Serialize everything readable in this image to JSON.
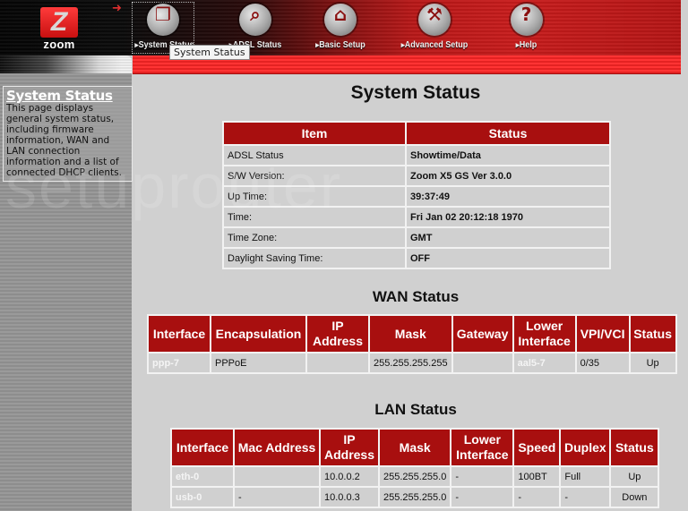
{
  "brand": {
    "logo_letter": "Z",
    "logo_text": "zoom"
  },
  "nav": [
    {
      "label": "System Status",
      "icon": "folders-icon",
      "glyph": "❐",
      "active": true
    },
    {
      "label": "ADSL Status",
      "icon": "magnifier-icon",
      "glyph": "⌕"
    },
    {
      "label": "Basic Setup",
      "icon": "house-icon",
      "glyph": "⌂"
    },
    {
      "label": "Advanced Setup",
      "icon": "wrench-icon",
      "glyph": "⚒"
    },
    {
      "label": "Help",
      "icon": "question-icon",
      "glyph": "?"
    }
  ],
  "tooltip": "System Status",
  "sidebar": {
    "title": "System Status",
    "text": "This page displays general system status, including firmware information, WAN and LAN connection information and a list of connected DHCP clients."
  },
  "watermark": "setuprouter",
  "page": {
    "title": "System Status"
  },
  "system": {
    "headers": [
      "Item",
      "Status"
    ],
    "rows": [
      [
        "ADSL Status",
        "Showtime/Data"
      ],
      [
        "S/W Version:",
        "Zoom X5 GS Ver 3.0.0"
      ],
      [
        "Up Time:",
        "39:37:49"
      ],
      [
        "Time:",
        "Fri Jan 02 20:12:18 1970"
      ],
      [
        "Time Zone:",
        "GMT"
      ],
      [
        "Daylight Saving Time:",
        "OFF"
      ]
    ]
  },
  "wan": {
    "title": "WAN Status",
    "headers": [
      "Interface",
      "Encapsulation",
      "IP Address",
      "Mask",
      "Gateway",
      "Lower Interface",
      "VPI/VCI",
      "Status"
    ],
    "rows": [
      [
        "ppp-7",
        "PPPoE",
        "",
        "255.255.255.255",
        "",
        "aal5-7",
        "0/35",
        "Up"
      ]
    ]
  },
  "lan": {
    "title": "LAN Status",
    "headers": [
      "Interface",
      "Mac Address",
      "IP Address",
      "Mask",
      "Lower Interface",
      "Speed",
      "Duplex",
      "Status"
    ],
    "rows": [
      [
        "eth-0",
        "",
        "10.0.0.2",
        "255.255.255.0",
        "-",
        "100BT",
        "Full",
        "Up"
      ],
      [
        "usb-0",
        "-",
        "10.0.0.3",
        "255.255.255.0",
        "-",
        "-",
        "-",
        "Down"
      ]
    ]
  }
}
